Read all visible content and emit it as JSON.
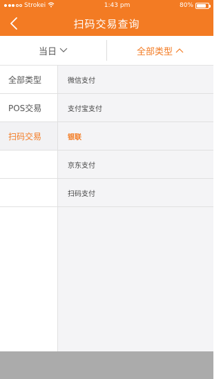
{
  "status_bar": {
    "carrier": "Strokei",
    "time": "1:43 pm",
    "battery": "80%",
    "battery_level": 0.8
  },
  "nav": {
    "title": "扫码交易查询",
    "back_icon": "chevron-left-icon"
  },
  "filters": {
    "date_label": "当日",
    "type_label": "全部类型"
  },
  "categories": [
    "全部类型",
    "POS交易",
    "扫码交易"
  ],
  "selected_category_index": 2,
  "sub_options": [
    "微信支付",
    "支付宝支付",
    "银联",
    "京东支付",
    "扫码支付"
  ],
  "selected_sub_index": 2,
  "colors": {
    "accent": "#f37b23",
    "sidebar_selected_bg": "#f2f2f4",
    "panel_bg": "#f4f4f6",
    "overlay": "#ababab"
  }
}
